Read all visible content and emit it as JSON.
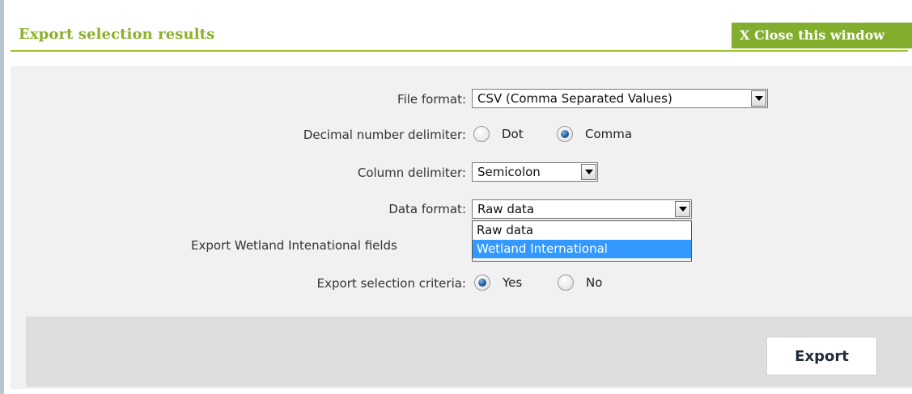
{
  "header": {
    "title": "Export selection results",
    "close_label": "X Close this window"
  },
  "form": {
    "file_format": {
      "label": "File format:",
      "value": "CSV (Comma Separated Values)"
    },
    "decimal_delimiter": {
      "label": "Decimal number delimiter:",
      "options": [
        "Dot",
        "Comma"
      ],
      "selected": "Comma"
    },
    "column_delimiter": {
      "label": "Column delimiter:",
      "value": "Semicolon"
    },
    "data_format": {
      "label": "Data format:",
      "value": "Raw data",
      "options": [
        "Raw data",
        "Wetland International"
      ],
      "highlighted": "Wetland International"
    },
    "wetland_fields": {
      "label": "Export Wetland Intenational fields"
    },
    "selection_criteria": {
      "label": "Export selection criteria:",
      "options": [
        "Yes",
        "No"
      ],
      "selected": "Yes"
    }
  },
  "footer": {
    "export_label": "Export"
  },
  "colors": {
    "title": "#8ab029",
    "close_bg": "#82ad2d",
    "highlight": "#3399ff",
    "panel": "#f1f1f1",
    "footer": "#dedede"
  }
}
